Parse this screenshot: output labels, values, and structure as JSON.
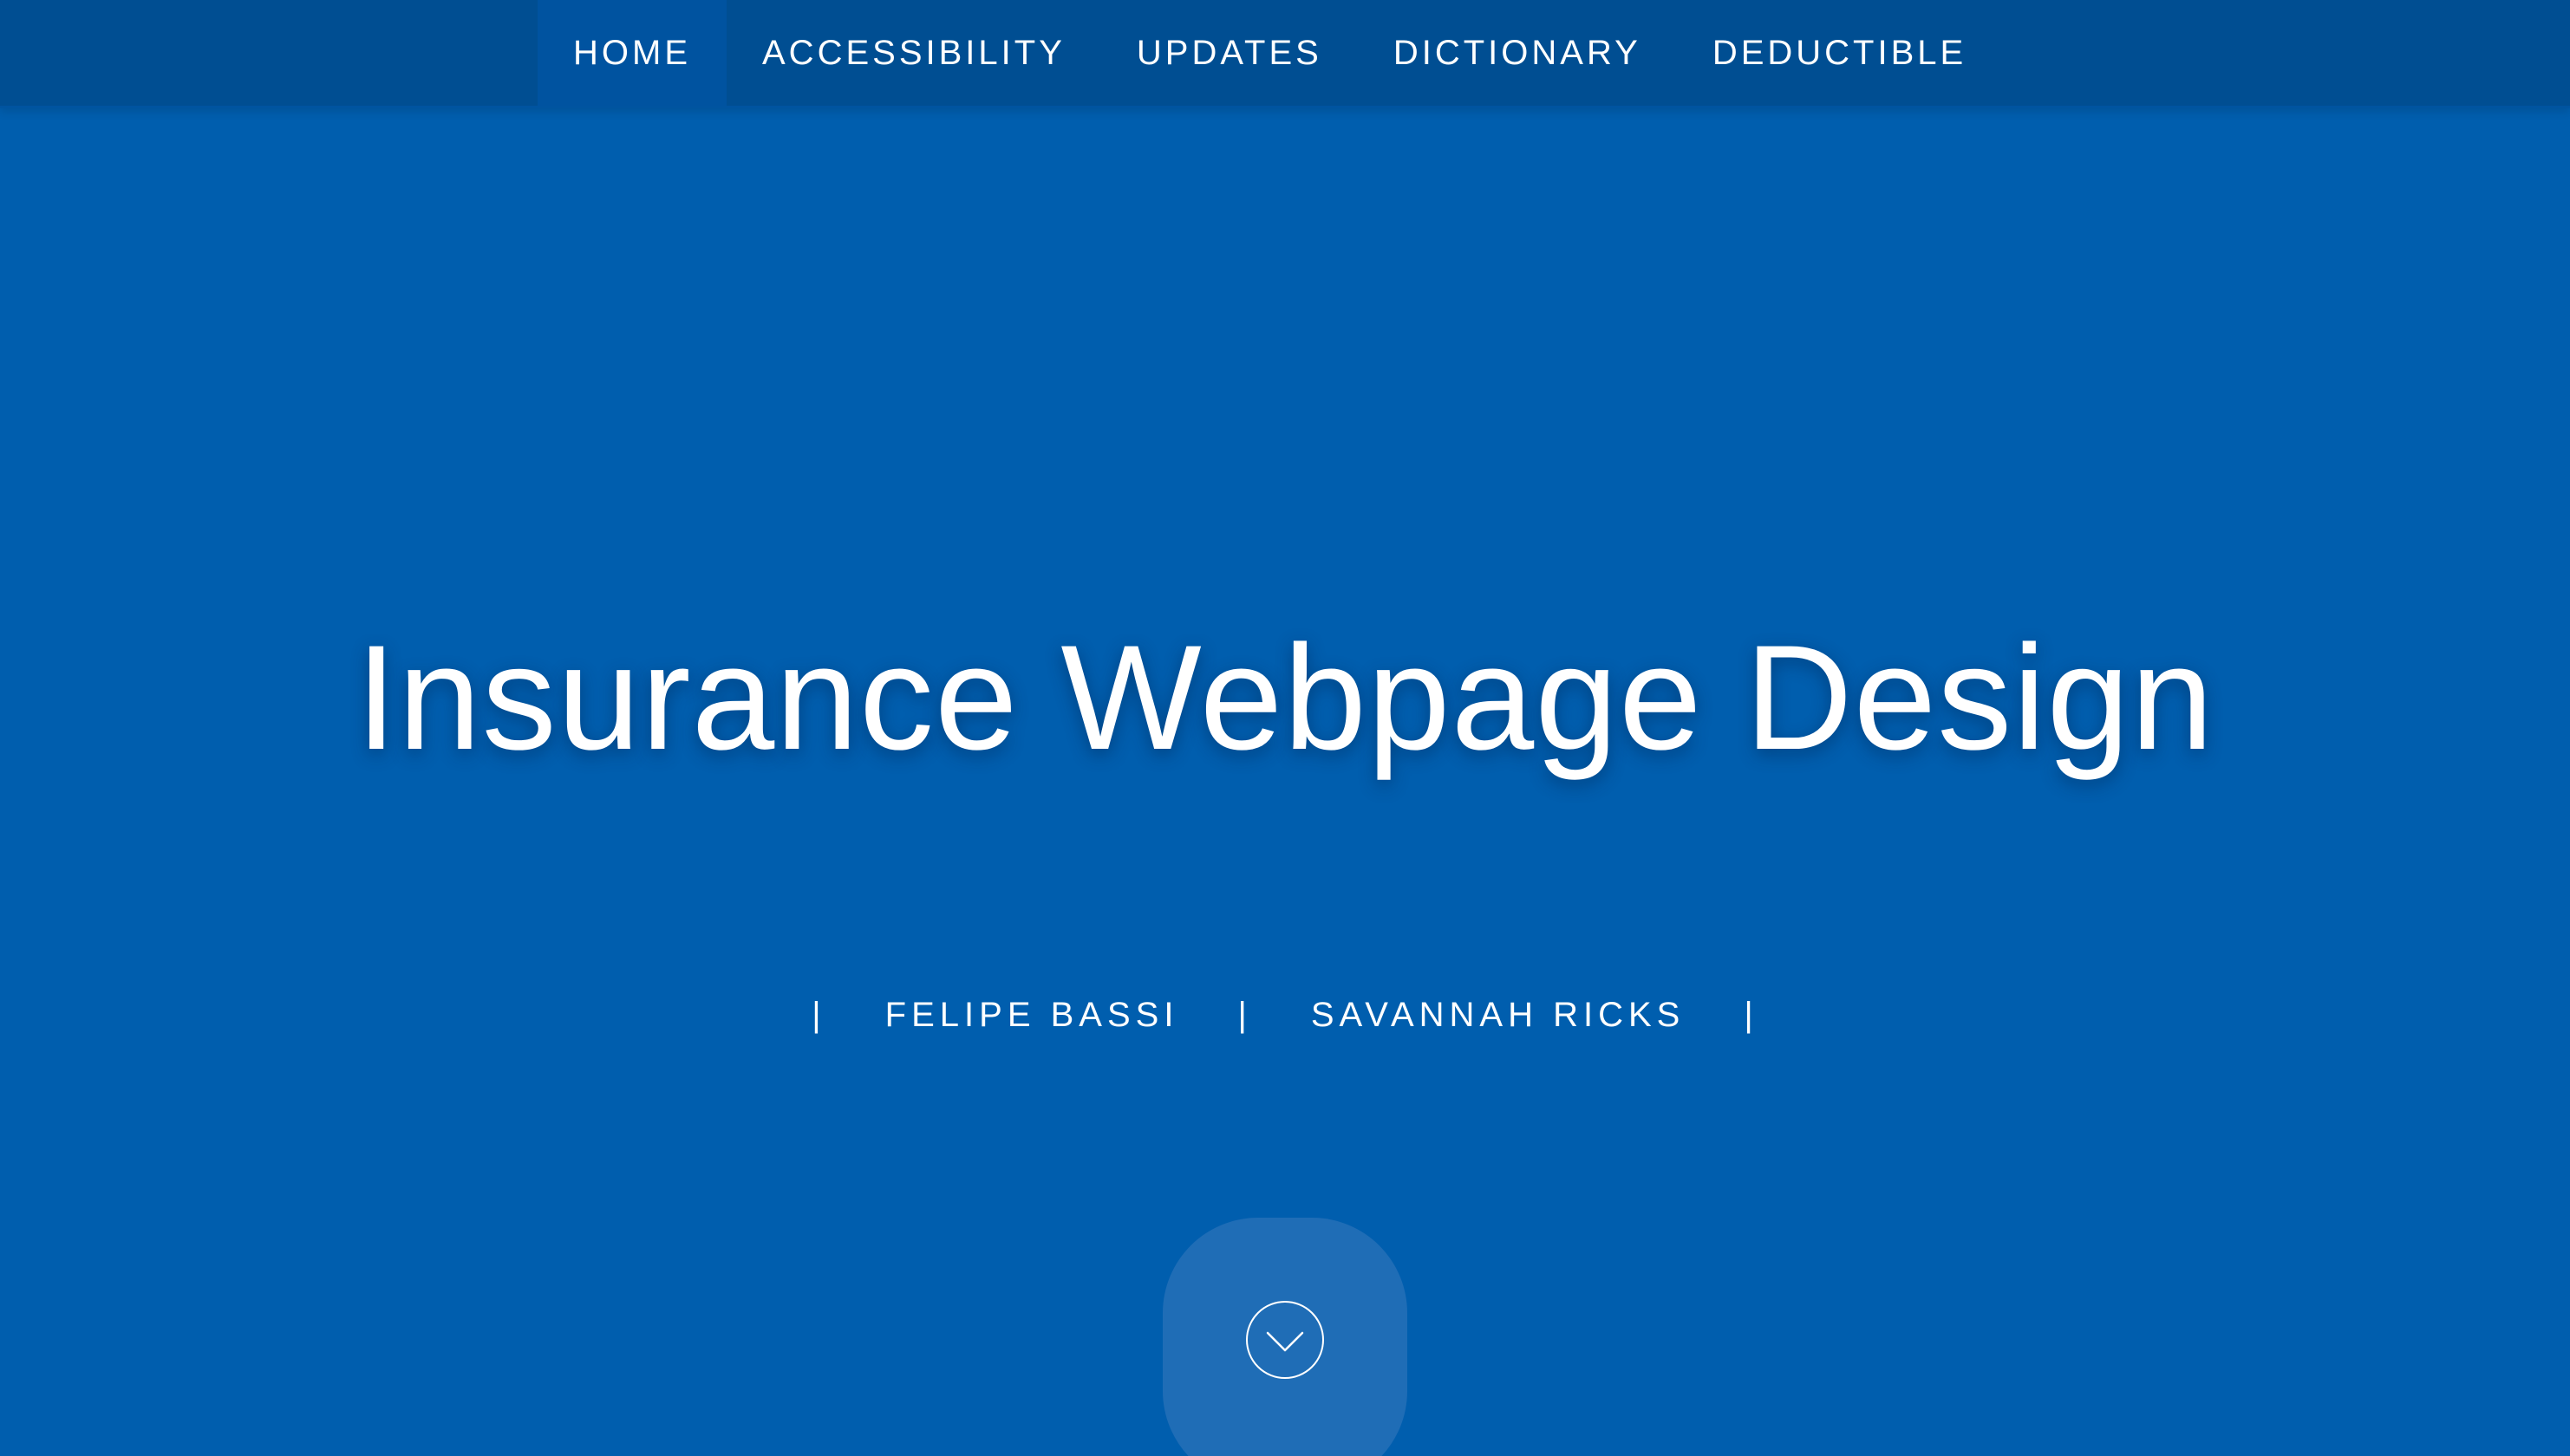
{
  "nav": {
    "items": [
      {
        "label": "HOME",
        "active": true
      },
      {
        "label": "ACCESSIBILITY",
        "active": false
      },
      {
        "label": "UPDATES",
        "active": false
      },
      {
        "label": "DICTIONARY",
        "active": false
      },
      {
        "label": "DEDUCTIBLE",
        "active": false
      }
    ]
  },
  "hero": {
    "title": "Insurance Webpage Design",
    "authors": {
      "separator": "|",
      "names": [
        "FELIPE BASSI",
        "SAVANNAH RICKS"
      ]
    },
    "scroll_button": {
      "icon": "chevron-down-icon"
    }
  },
  "colors": {
    "background": "#005eae",
    "navbar": "#004e92",
    "nav_active": "#0053a0",
    "scroll_button": "#1f6db6",
    "text": "#ffffff"
  }
}
